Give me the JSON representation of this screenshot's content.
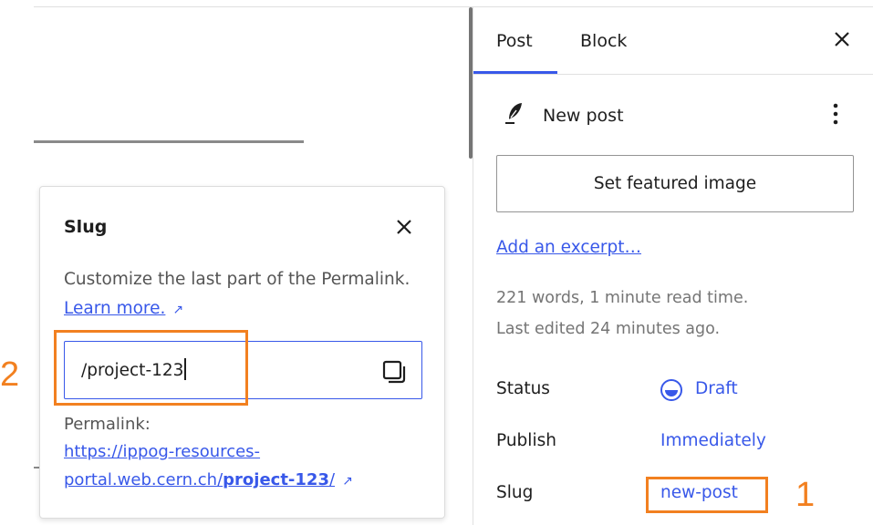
{
  "sidebar": {
    "tabs": [
      {
        "label": "Post",
        "active": true
      },
      {
        "label": "Block",
        "active": false
      }
    ],
    "close_icon": "close-icon",
    "post_title": "New post",
    "post_icon": "feather-icon",
    "more_icon": "more-vertical-icon",
    "featured_image_button": "Set featured image",
    "excerpt_link": "Add an excerpt…",
    "meta_words": "221 words, 1 minute read time.",
    "meta_edited": "Last edited 24 minutes ago.",
    "rows": {
      "status_label": "Status",
      "status_value": "Draft",
      "publish_label": "Publish",
      "publish_value": "Immediately",
      "slug_label": "Slug",
      "slug_value": "new-post"
    }
  },
  "popover": {
    "title": "Slug",
    "description": "Customize the last part of the Permalink.",
    "learn_more": "Learn more.",
    "input_value": "/project-123",
    "copy_icon": "copy-icon",
    "permalink_label": "Permalink:",
    "permalink_line1": "https://ippog-resources-",
    "permalink_line2_prefix": "portal.web.cern.ch/",
    "permalink_line2_slug": "project-123",
    "permalink_line2_suffix": "/"
  },
  "annotations": {
    "marker_1": "1",
    "marker_2": "2",
    "highlight_color": "#f28020"
  },
  "colors": {
    "accent": "#3858e9",
    "text": "#1e1e1e",
    "muted": "#757575"
  }
}
